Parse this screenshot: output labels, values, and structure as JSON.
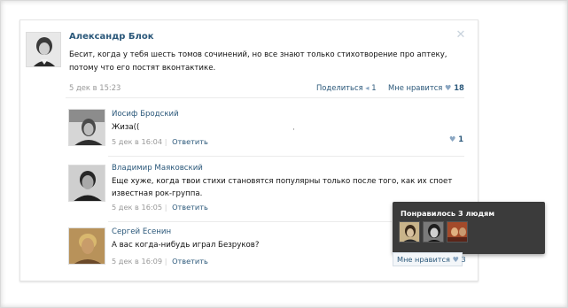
{
  "post": {
    "author": "Александр Блок",
    "text": "Бесит, когда у тебя шесть томов сочинений, но все знают только стихотворение про аптеку, потому что его постят вконтактике.",
    "date": "5 дек в 15:23",
    "share_label": "Поделиться",
    "share_count": "1",
    "like_label": "Мне нравится",
    "like_count": "18",
    "close_symbol": "✕"
  },
  "comments": [
    {
      "author": "Иосиф Бродский",
      "text": "Жиза((",
      "date": "5 дек в 16:04",
      "reply_label": "Ответить",
      "likes": "1"
    },
    {
      "author": "Владимир Маяковский",
      "text": "Еще хуже, когда твои стихи становятся популярны только после того, как их споет известная рок-группа.",
      "date": "5 дек в 16:05",
      "reply_label": "Ответить"
    },
    {
      "author": "Сергей Есенин",
      "text": "А вас когда-нибудь играл Безруков?",
      "date": "5 дек в 16:09",
      "reply_label": "Ответить",
      "like_label": "Мне нравится",
      "likes": "3"
    }
  ],
  "tooltip": {
    "title": "Понравилось 3 людям",
    "avatars": [
      "person-avatar-1",
      "person-avatar-2",
      "person-avatar-3"
    ]
  },
  "icons": {
    "heart": "♥",
    "share": "◂"
  },
  "colors": {
    "link": "#2b587a",
    "muted": "#999999",
    "tooltip_bg": "#3b3b3b"
  }
}
